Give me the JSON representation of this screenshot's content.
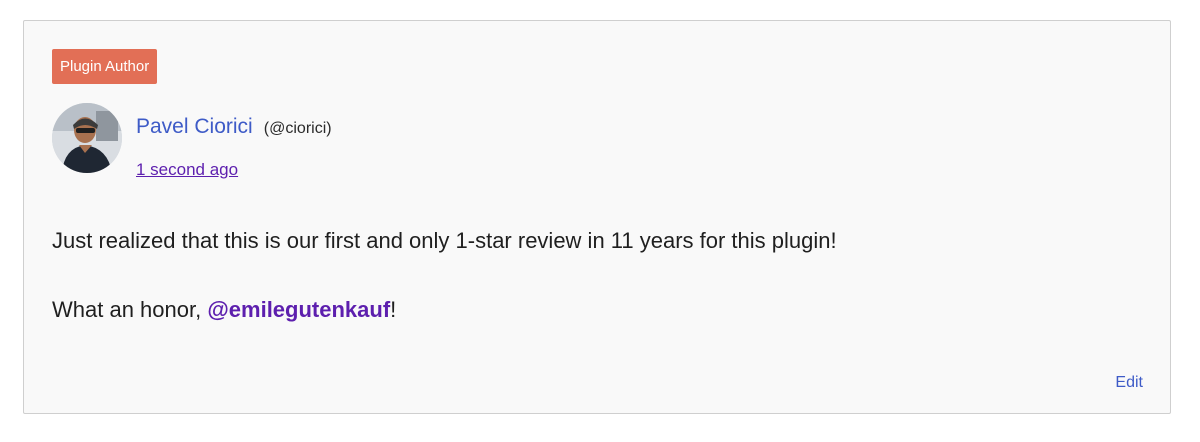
{
  "reply": {
    "badge": "Plugin Author",
    "author": {
      "name": "Pavel Ciorici",
      "handle": "(@ciorici)"
    },
    "timestamp": "1 second ago",
    "paragraph_1": "Just realized that this is our first and only 1-star review in 11 years for this plugin!",
    "paragraph_2_prefix": "What an honor, ",
    "mention": "@emilegutenkauf",
    "paragraph_2_suffix": "!",
    "edit_label": "Edit"
  },
  "colors": {
    "badge_bg": "#e26f56",
    "author_link": "#3e5bc7",
    "visited_link": "#5d1fae",
    "card_bg": "#f9f9f9",
    "card_border": "#cfcfcf"
  },
  "icons": {
    "avatar": "user-photo-avatar"
  }
}
